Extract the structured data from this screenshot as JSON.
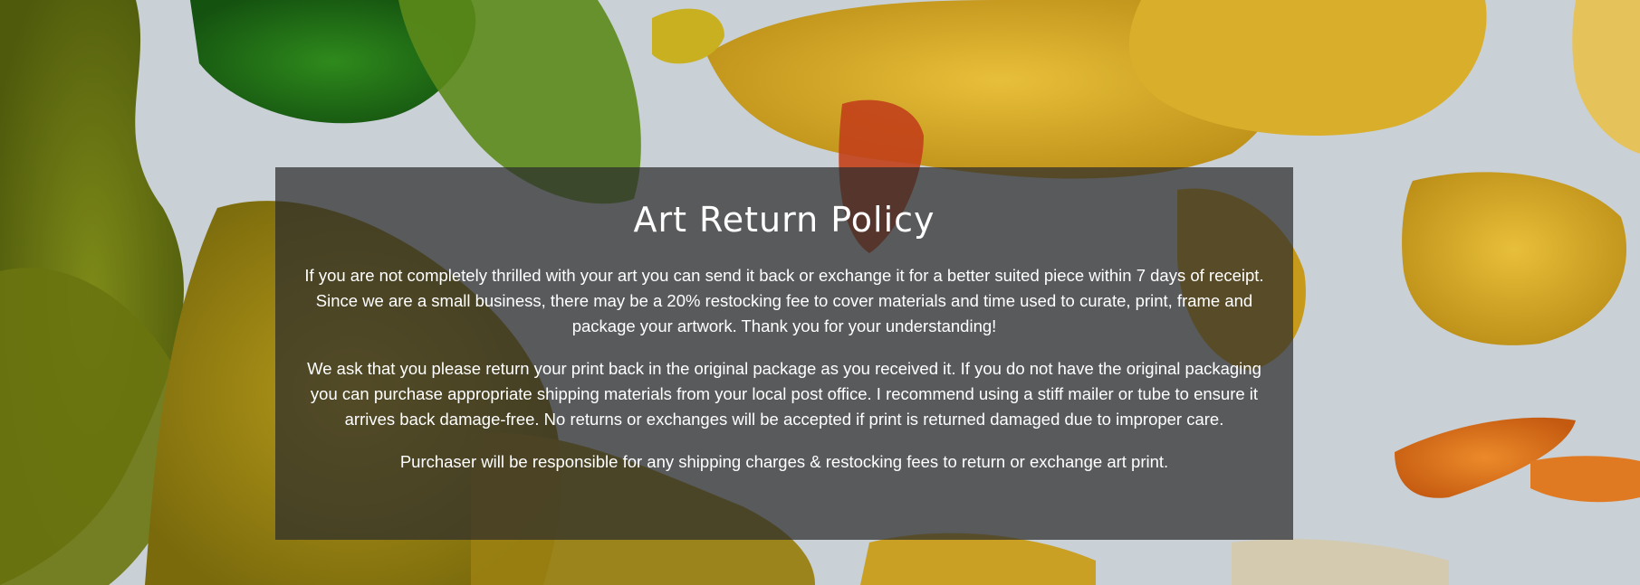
{
  "policy": {
    "title": "Art Return Policy",
    "paragraphs": [
      "If you are not completely thrilled with your art you can send it back or exchange it for a better suited piece within 7 days of receipt. Since we are a small business, there may be a 20% restocking fee to cover materials and time used to curate, print, frame and package your artwork. Thank you for your understanding!",
      "We ask that you please return your print back in the original package as you received it. If you do not have the original packaging you can purchase appropriate shipping materials from your local post office. I recommend using a stiff mailer or tube to ensure it arrives back damage-free. No returns or exchanges will be accepted if print is returned damaged due to improper care.",
      "Purchaser will be responsible for any shipping charges & restocking fees to return or exchange art print."
    ]
  },
  "background": {
    "canvas_color": "#c9d0d6",
    "paint_colors": [
      "#6b7a12",
      "#1f6b14",
      "#c9a21c",
      "#e0b42a",
      "#d4681a",
      "#8a8a10"
    ]
  }
}
